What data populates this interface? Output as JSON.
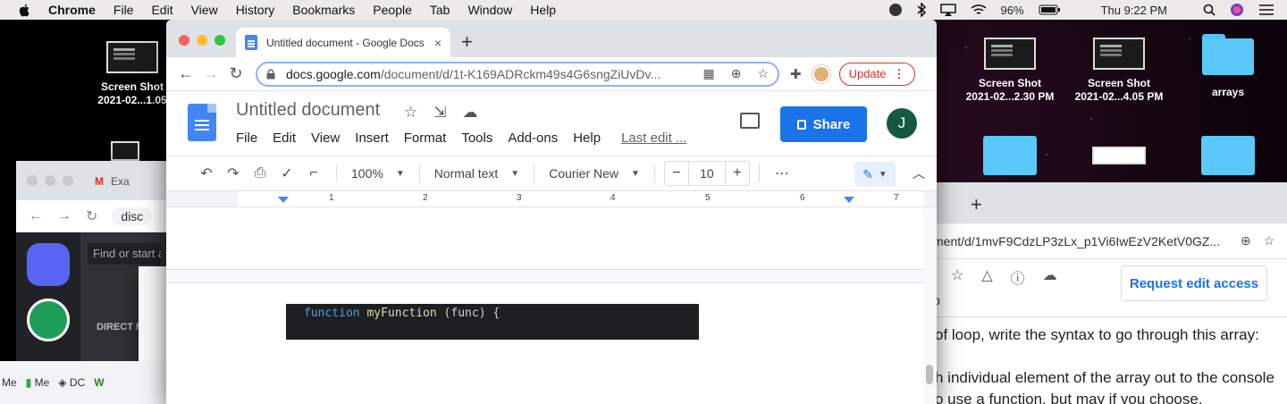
{
  "menubar": {
    "app": "Chrome",
    "items": [
      "File",
      "Edit",
      "View",
      "History",
      "Bookmarks",
      "People",
      "Tab",
      "Window",
      "Help"
    ],
    "battery": "96%",
    "clock": "Thu 9:22 PM"
  },
  "desktop": {
    "icons": [
      {
        "label1": "Screen Shot",
        "label2": "2021-02...1.05",
        "kind": "screenshot"
      },
      {
        "label1": "Screen Shot",
        "label2": "2021-02...2.30 PM",
        "kind": "screenshot"
      },
      {
        "label1": "Screen Shot",
        "label2": "2021-02...4.05 PM",
        "kind": "screenshot"
      },
      {
        "label1": "arrays",
        "label2": "",
        "kind": "folder"
      }
    ],
    "partial_label": "e"
  },
  "background_windows": {
    "gmail_tab": "Exa",
    "disc_url": "disc",
    "find_placeholder": "Find or start a",
    "direct": "DIRECT M",
    "bookmarks": [
      "Me",
      "Me",
      "DC"
    ]
  },
  "tab": {
    "title": "Untitled document - Google Docs",
    "close": "×",
    "new_tab": "+"
  },
  "omnibox": {
    "url_host": "docs.google.com",
    "url_path": "/document/d/1t-K169ADRckm49s4G6sngZiUvDv..."
  },
  "update_button": "Update",
  "doc": {
    "title": "Untitled document",
    "menu": [
      "File",
      "Edit",
      "View",
      "Insert",
      "Format",
      "Tools",
      "Add-ons",
      "Help"
    ],
    "last_edit": "Last edit ...",
    "share": "Share",
    "user_initial": "J"
  },
  "format_toolbar": {
    "zoom": "100%",
    "style": "Normal text",
    "font": "Courier New",
    "font_size": "10",
    "minus": "−",
    "plus": "+"
  },
  "ruler": [
    "1",
    "2",
    "3",
    "4",
    "5",
    "6",
    "7"
  ],
  "code": {
    "keyword": "function",
    "name": "myFunction",
    "rest": " (func) {"
  },
  "right_window": {
    "url": "ment/d/1mvF9CdzLP3zLx_p1Vi6IwEzV2KetV0GZ...",
    "request": "Request edit access",
    "partial_b": "b",
    "lines": [
      "of loop, write the syntax to go through this array:",
      "h individual element of the array out to the console",
      "o use a function, but may if you choose."
    ]
  }
}
